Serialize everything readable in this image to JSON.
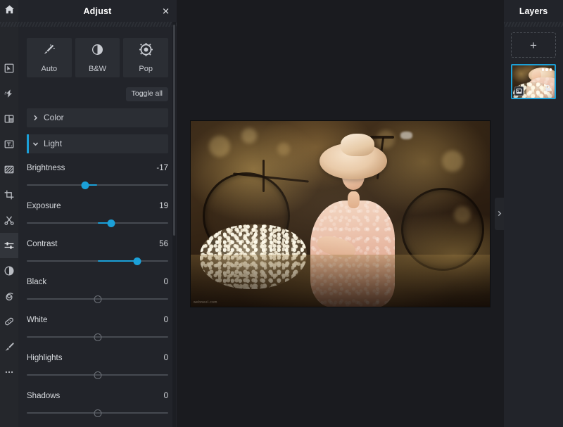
{
  "app": {
    "accent": "#1ba0d8",
    "panel_bg": "#22242a",
    "canvas_bg": "#1a1b1f",
    "rail_bg": "#25272c"
  },
  "rail": {
    "home_icon": "home-icon",
    "tools": [
      {
        "name": "select",
        "icon": "cursor-arrow-icon",
        "active": false
      },
      {
        "name": "effects",
        "icon": "lightning-bolt-icon",
        "active": false
      },
      {
        "name": "frames",
        "icon": "frame-layout-icon",
        "active": false
      },
      {
        "name": "text",
        "icon": "text-box-icon",
        "active": false
      },
      {
        "name": "overlay",
        "icon": "hatched-rectangle-icon",
        "active": false
      },
      {
        "name": "crop",
        "icon": "crop-icon",
        "active": false
      },
      {
        "name": "cutout",
        "icon": "scissors-icon",
        "active": false
      },
      {
        "name": "adjust",
        "icon": "sliders-icon",
        "active": true
      },
      {
        "name": "contrast",
        "icon": "half-circle-icon",
        "active": false
      },
      {
        "name": "blur",
        "icon": "spiral-icon",
        "active": false
      },
      {
        "name": "heal",
        "icon": "bandage-icon",
        "active": false
      },
      {
        "name": "brush",
        "icon": "brush-icon",
        "active": false
      },
      {
        "name": "more",
        "icon": "ellipsis-icon",
        "active": false
      }
    ]
  },
  "panel": {
    "title": "Adjust",
    "close_label": "✕",
    "presets": [
      {
        "label": "Auto",
        "icon": "magic-wand-icon"
      },
      {
        "label": "B&W",
        "icon": "half-filled-circle-icon"
      },
      {
        "label": "Pop",
        "icon": "gear-sun-icon"
      }
    ],
    "toggle_all_label": "Toggle all",
    "sections": [
      {
        "label": "Color",
        "open": false,
        "chevron": "chevron-right-icon"
      },
      {
        "label": "Light",
        "open": true,
        "chevron": "chevron-down-icon"
      }
    ],
    "sliders": [
      {
        "label": "Brightness",
        "value": "-17",
        "percent": 41.5,
        "active": true
      },
      {
        "label": "Exposure",
        "value": "19",
        "percent": 59.5,
        "active": true
      },
      {
        "label": "Contrast",
        "value": "56",
        "percent": 78.0,
        "active": true
      },
      {
        "label": "Black",
        "value": "0",
        "percent": 50.0,
        "active": false
      },
      {
        "label": "White",
        "value": "0",
        "percent": 50.0,
        "active": false
      },
      {
        "label": "Highlights",
        "value": "0",
        "percent": 50.0,
        "active": false
      },
      {
        "label": "Shadows",
        "value": "0",
        "percent": 50.0,
        "active": false
      }
    ]
  },
  "canvas": {
    "image_alt": "Vintage sepia photo of a woman in a wide-brim sun hat holding white flowers beside a bicycle",
    "watermark": "webneel.com",
    "collapse_icon": "chevron-right-icon"
  },
  "layers": {
    "title": "Layers",
    "add_label": "+",
    "items": [
      {
        "name": "photo-layer",
        "selected": true,
        "menu_icon": "ellipsis-icon",
        "type_icon": "image-icon",
        "lock_icon": "lock-icon"
      }
    ]
  }
}
